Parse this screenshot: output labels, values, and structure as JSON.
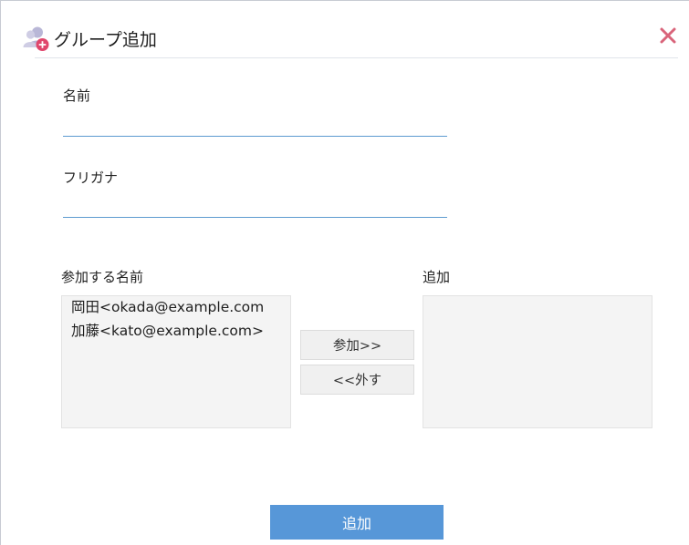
{
  "dialog": {
    "title": "グループ追加",
    "icon": "add-group-icon",
    "close_icon": "close-icon"
  },
  "form": {
    "name_label": "名前",
    "name_value": "",
    "furigana_label": "フリガナ",
    "furigana_value": ""
  },
  "members": {
    "available_label": "参加する名前",
    "available": [
      "岡田<okada@example.com",
      "加藤<kato@example.com>"
    ],
    "added_label": "追加",
    "added": []
  },
  "buttons": {
    "add_label": "参加>>",
    "remove_label": "<<外す",
    "submit_label": "追加"
  },
  "colors": {
    "accent": "#5797d8",
    "input_underline": "#5d9bd0",
    "close": "#d9647a",
    "icon_person": "#b9b7d7",
    "icon_badge": "#e0466c"
  }
}
